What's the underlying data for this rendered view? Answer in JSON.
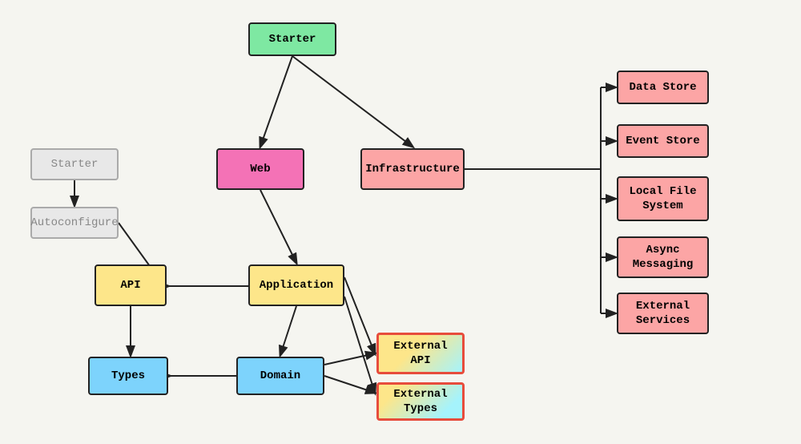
{
  "nodes": {
    "starter_main": {
      "label": "Starter",
      "bg": "#7ee8a2"
    },
    "web": {
      "label": "Web",
      "bg": "#f472b6"
    },
    "infrastructure": {
      "label": "Infrastructure",
      "bg": "#fca5a5"
    },
    "application": {
      "label": "Application",
      "bg": "#fde68a"
    },
    "api": {
      "label": "API",
      "bg": "#fde68a"
    },
    "types": {
      "label": "Types",
      "bg": "#7dd3fc"
    },
    "domain": {
      "label": "Domain",
      "bg": "#7dd3fc"
    },
    "external_api": {
      "label": "External API",
      "bg": "gradient"
    },
    "external_types": {
      "label": "External Types",
      "bg": "gradient"
    },
    "data_store": {
      "label": "Data Store",
      "bg": "#fca5a5"
    },
    "event_store": {
      "label": "Event Store",
      "bg": "#fca5a5"
    },
    "local_fs": {
      "label": "Local\nFile System",
      "bg": "#fca5a5"
    },
    "async_messaging": {
      "label": "Async\nMessaging",
      "bg": "#fca5a5"
    },
    "external_services": {
      "label": "External\nServices",
      "bg": "#fca5a5"
    },
    "ghost_starter": {
      "label": "Starter",
      "bg": "#e8e8e8"
    },
    "ghost_autoconfig": {
      "label": "Autoconfigure",
      "bg": "#e8e8e8"
    }
  }
}
